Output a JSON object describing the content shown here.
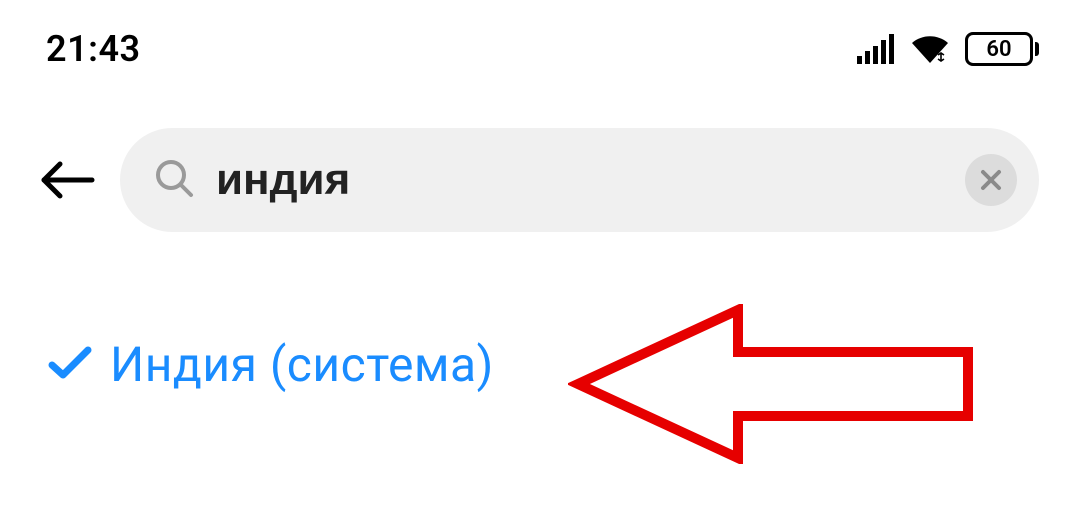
{
  "statusbar": {
    "time": "21:43",
    "battery_level": "60"
  },
  "search": {
    "value": "индия",
    "placeholder": ""
  },
  "result": {
    "name": "Индия",
    "suffix": "(система)"
  },
  "colors": {
    "accent": "#1a8cff",
    "annotation": "#e60000"
  }
}
